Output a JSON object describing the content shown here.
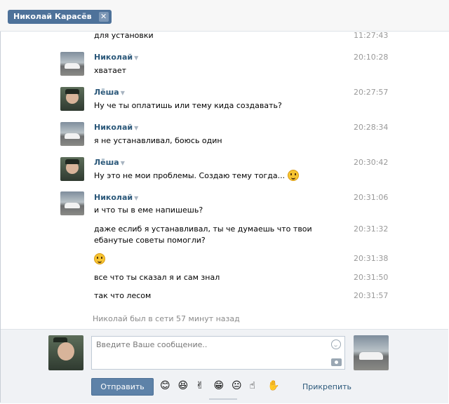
{
  "header": {
    "dialog_title": "Николай Карасёв",
    "close_glyph": "✕"
  },
  "messages": [
    {
      "author": "",
      "text": "для установки",
      "time": "11:27:43"
    },
    {
      "author": "Николай",
      "text": "хватает",
      "time": "20:10:28"
    },
    {
      "author": "Лёша",
      "text": "Ну че ты оплатишь или тему кида создавать?",
      "time": "20:27:57"
    },
    {
      "author": "Николай",
      "text": "я не устанавливал, боюсь один",
      "time": "20:28:34"
    },
    {
      "author": "Лёша",
      "text": "Ну это не мои проблемы. Создаю тему тогда...",
      "time": "20:30:42"
    },
    {
      "author": "Николай",
      "text": "и что ты в еме напишешь?",
      "time": "20:31:06"
    },
    {
      "author": "",
      "text": "даже еслиб я устанавливал, ты че думаешь что твои ебанутые советы помогли?",
      "time": "20:31:32"
    },
    {
      "author": "",
      "text": "",
      "time": "20:31:38"
    },
    {
      "author": "",
      "text": "все что ты сказал я и сам знал",
      "time": "20:31:50"
    },
    {
      "author": "",
      "text": "так что лесом",
      "time": "20:31:57"
    }
  ],
  "status_line": "Николай был в сети 57 минут назад",
  "composer": {
    "placeholder": "Введите Ваше сообщение..",
    "send_label": "Отправить",
    "attach_label": "Прикрепить",
    "emoji": [
      "😊",
      "😆",
      "✌",
      "😁",
      "😐",
      "☝",
      "✋"
    ]
  },
  "colors": {
    "accent": "#2b587a",
    "button": "#5e82a8",
    "chip": "#4e729a"
  }
}
